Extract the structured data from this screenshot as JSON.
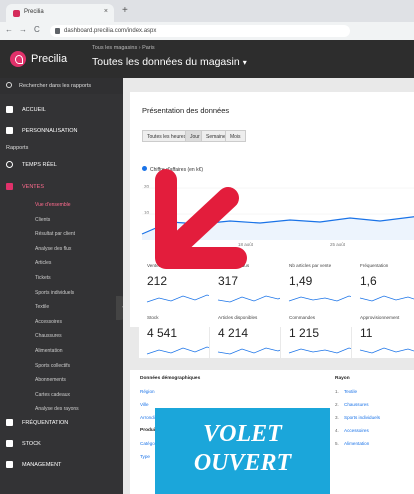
{
  "browser": {
    "tab_title": "Precilia",
    "close": "×",
    "new_tab": "+",
    "back": "←",
    "forward": "→",
    "reload": "C",
    "url": "dashboard.precilia.com/index.aspx"
  },
  "app": {
    "brand": "Precilia",
    "scope": "Tous les magasins › Paris",
    "title": "Toutes les données du magasin",
    "title_caret": "▾"
  },
  "sidebar": {
    "search_label": "Rechercher dans les rapports",
    "items_top": [
      {
        "label": "ACCUEIL"
      },
      {
        "label": "PERSONNALISATION"
      }
    ],
    "reports_label": "Rapports",
    "realtime": "TEMPS RÉEL",
    "sales": "VENTES",
    "sales_sub": [
      "Vue d'ensemble",
      "Clients",
      "Résultat par client",
      "Analyse des flux",
      "Articles",
      "Tickets",
      "Sports individuels",
      "Textile",
      "Accessoires",
      "Chaussures",
      "Alimentation",
      "Sports collectifs",
      "Abonnements",
      "Cartes cadeaux",
      "Analyse des rayons"
    ],
    "items_bottom": [
      {
        "label": "FRÉQUENTATION"
      },
      {
        "label": "STOCK"
      },
      {
        "label": "MANAGEMENT"
      }
    ],
    "collapse_glyph": "‹"
  },
  "main": {
    "overview_title": "Présentation des données",
    "periods": [
      "Toutes les heures",
      "Jour",
      "Semaine",
      "Mois"
    ],
    "active_period": "Jour",
    "legend": "Chiffre d'affaires (en k€)",
    "y_ticks": [
      "20",
      "10"
    ],
    "x_ticks": [
      "18 août",
      "25 août"
    ],
    "metrics_row1": [
      {
        "label": "Ventes",
        "value": "212"
      },
      {
        "label": "Articles vendus",
        "value": "317"
      },
      {
        "label": "Nb articles par vente",
        "value": "1,49"
      },
      {
        "label": "Fréquentation",
        "value": "1,6"
      }
    ],
    "metrics_row2": [
      {
        "label": "Stock",
        "value": "4 541"
      },
      {
        "label": "Articles disponibles",
        "value": "4 214"
      },
      {
        "label": "Commandes",
        "value": "1 215"
      },
      {
        "label": "Approvisionnement",
        "value": "11"
      }
    ],
    "demo_header": "Données démographiques",
    "demo_rows": [
      "Région",
      "Ville",
      "Arrondissement"
    ],
    "products_header": "Produits",
    "products_rows": [
      "Catégorie",
      "Type"
    ],
    "rayon_header": "Rayon",
    "rayon_rows": [
      {
        "num": "1.",
        "name": "Textile"
      },
      {
        "num": "2.",
        "name": "Chaussures"
      },
      {
        "num": "3.",
        "name": "Sports individuels"
      },
      {
        "num": "4.",
        "name": "Accessoires"
      },
      {
        "num": "5.",
        "name": "Alimentation"
      }
    ]
  },
  "overlay": {
    "line1": "VOLET",
    "line2": "OUVERT",
    "arrow_color": "#e31d3c",
    "banner_color": "#1ba6da"
  },
  "colors": {
    "accent": "#e0316a",
    "sidebar_bg": "#333335",
    "chart_line": "#1a73e8"
  }
}
